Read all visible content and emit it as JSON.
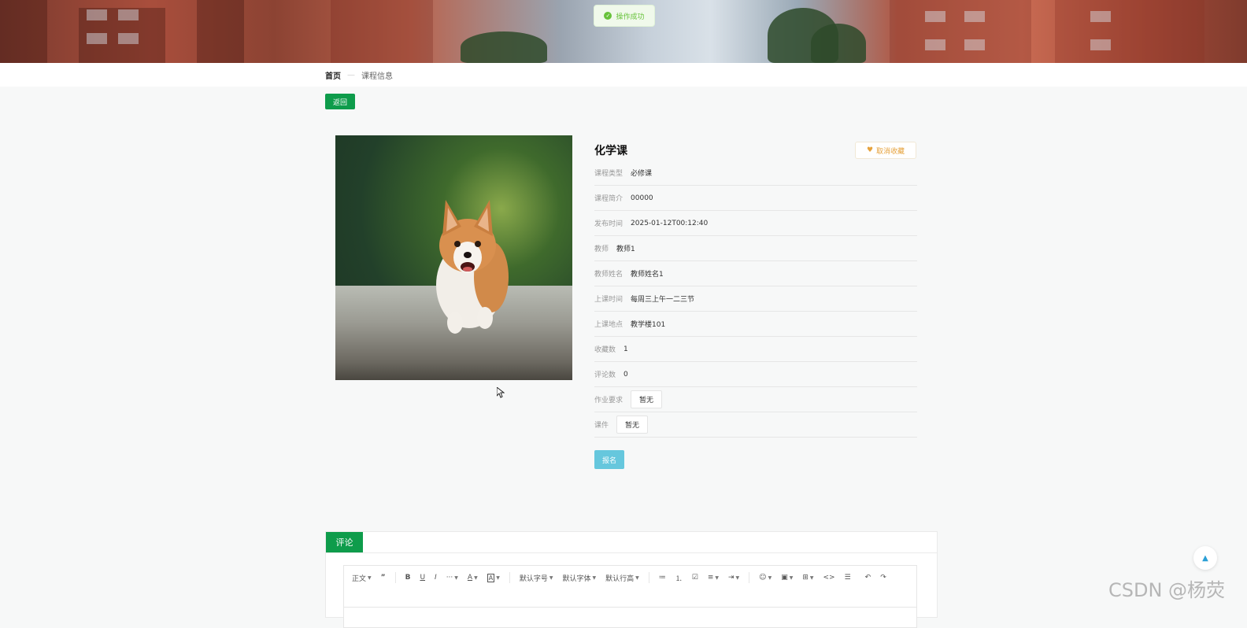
{
  "toast": {
    "icon": "check-circle-icon",
    "text": "操作成功"
  },
  "breadcrumb": {
    "home": "首页",
    "separator": "—",
    "current": "课程信息"
  },
  "back_button": "返回",
  "course": {
    "title": "化学课",
    "favorite_button": "取消收藏",
    "fields": [
      {
        "label": "课程类型",
        "value": "必修课"
      },
      {
        "label": "课程简介",
        "value": "00000"
      },
      {
        "label": "发布时间",
        "value": "2025-01-12T00:12:40"
      },
      {
        "label": "教师",
        "value": "教师1"
      },
      {
        "label": "教师姓名",
        "value": "教师姓名1"
      },
      {
        "label": "上课时间",
        "value": "每周三上午一二三节"
      },
      {
        "label": "上课地点",
        "value": "教学楼101"
      },
      {
        "label": "收藏数",
        "value": "1"
      },
      {
        "label": "评论数",
        "value": "0"
      },
      {
        "label": "作业要求",
        "value": "暂无"
      },
      {
        "label": "课件",
        "value": "暂无"
      }
    ],
    "signup_button": "报名"
  },
  "comments": {
    "tab": "评论",
    "toolbar": [
      "正文",
      "”",
      "B",
      "U",
      "I",
      "···",
      "A",
      "A",
      "默认字号",
      "默认字体",
      "默认行高",
      "≔",
      "⒈",
      "☑",
      "≡",
      "⇥",
      "☺",
      "▣",
      "⊞",
      "<>",
      "☰",
      "↶",
      "↷"
    ]
  },
  "scroll_top": "▲",
  "watermark": "CSDN @杨荧",
  "colors": {
    "primary": "#0e9c4b",
    "signup": "#66c7dd",
    "favorite": "#e6a23c",
    "toast_bg": "#f0f9eb"
  }
}
